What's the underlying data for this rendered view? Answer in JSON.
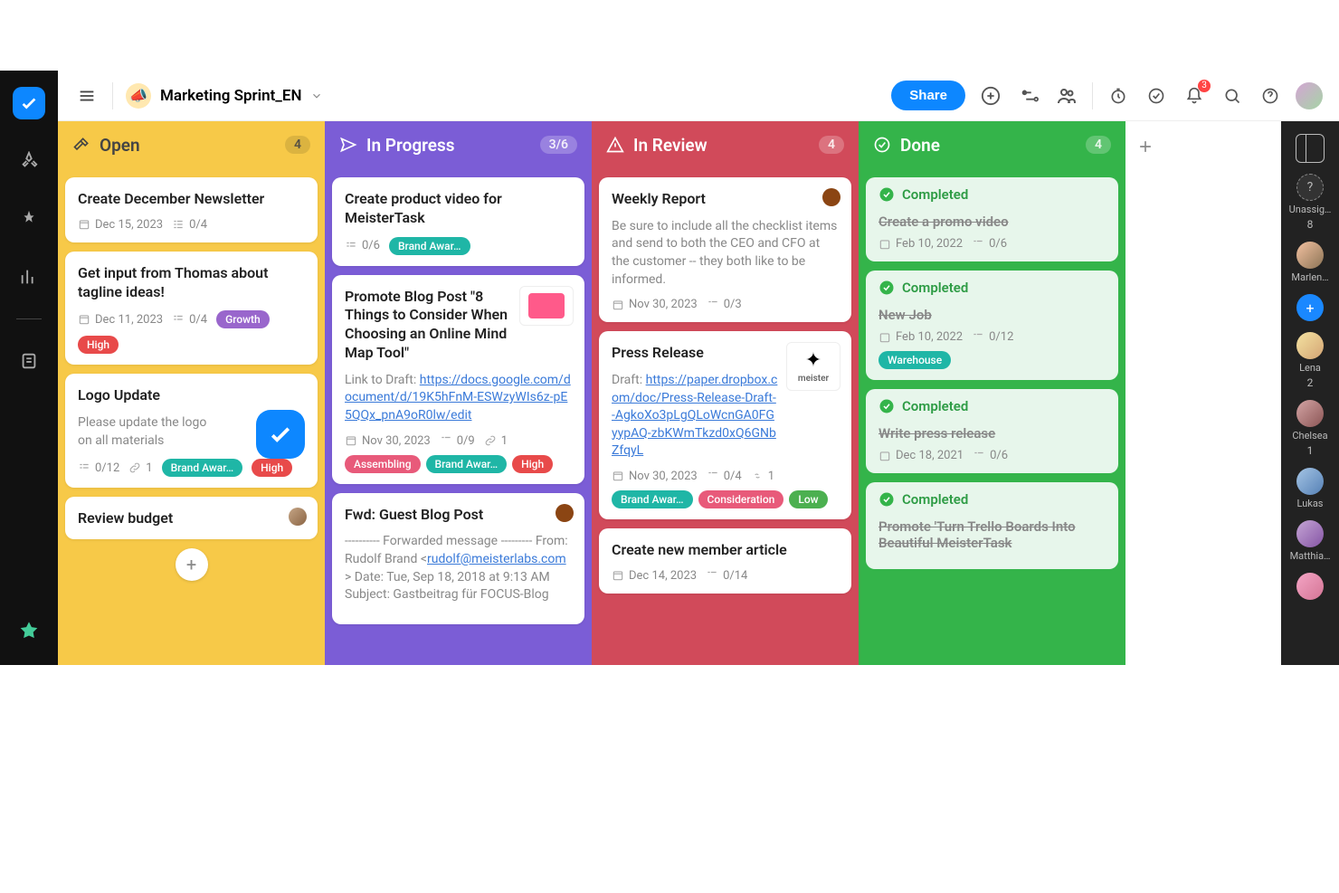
{
  "board": {
    "name": "Marketing Sprint_EN",
    "emoji": "📣"
  },
  "topbar": {
    "share": "Share",
    "notification_count": "3"
  },
  "columns": [
    {
      "key": "open",
      "title": "Open",
      "count": "4",
      "color": "yellow",
      "icon": "hammer"
    },
    {
      "key": "progress",
      "title": "In Progress",
      "count": "3/6",
      "color": "purple",
      "icon": "plane"
    },
    {
      "key": "review",
      "title": "In Review",
      "count": "4",
      "color": "red",
      "icon": "warning"
    },
    {
      "key": "done",
      "title": "Done",
      "count": "4",
      "color": "green",
      "icon": "check"
    }
  ],
  "open_cards": [
    {
      "title": "Create December Newsletter",
      "date": "Dec 15, 2023",
      "checklist": "0/4"
    },
    {
      "title": "Get input from Thomas about tagline ideas!",
      "date": "Dec 11, 2023",
      "checklist": "0/4",
      "tags": [
        "Growth",
        "High"
      ]
    },
    {
      "title": "Logo Update",
      "desc": "Please update the logo on all materials",
      "checklist": "0/12",
      "attachments": "1",
      "tags": [
        "Brand Awar…",
        "High"
      ],
      "bigcheck": true
    },
    {
      "title": "Review budget",
      "avatar": true
    }
  ],
  "progress_cards": [
    {
      "title": "Create product video for MeisterTask",
      "checklist": "0/6",
      "tags": [
        "Brand Awar…"
      ]
    },
    {
      "title": "Promote Blog Post \"8 Things to Consider When Choosing an Online Mind Map Tool\"",
      "desc_prefix": "Link to Draft:",
      "link": "https://docs.google.com/document/d/19K5hFnM-ESWzyWIs6z-pE5QQx_pnA9oR0lw/edit",
      "date": "Nov 30, 2023",
      "checklist": "0/9",
      "attachments": "1",
      "tags": [
        "Assembling",
        "Brand Awar…",
        "High"
      ],
      "thumb": "pink"
    },
    {
      "title": "Fwd: Guest Blog Post",
      "desc": "---------- Forwarded message --------- From: Rudolf Brand <",
      "email": "rudolf@meisterlabs.com",
      "desc2": "> Date: Tue, Sep 18, 2018 at 9:13 AM Subject: Gastbeitrag für FOCUS-Blog",
      "avatar": true
    }
  ],
  "review_cards": [
    {
      "title": "Weekly Report",
      "desc": "Be sure to include all the checklist items and send to both the CEO and CFO at the customer -- they both like to be informed.",
      "date": "Nov 30, 2023",
      "checklist": "0/3",
      "avatar": true
    },
    {
      "title": "Press Release",
      "desc_prefix": "Draft:",
      "link": "https://paper.dropbox.com/doc/Press-Release-Draft--AgkoXo3pLgQLoWcnGA0FGyypAQ-zbKWmTkzd0xQ6GNbZfqyL",
      "date": "Nov 30, 2023",
      "checklist": "0/4",
      "attachments": "1",
      "tags": [
        "Brand Awar…",
        "Consideration",
        "Low"
      ],
      "logo": "meister"
    },
    {
      "title": "Create new member article",
      "date": "Dec 14, 2023",
      "checklist": "0/14"
    }
  ],
  "done_cards": [
    {
      "status": "Completed",
      "title": "Create a promo video",
      "date": "Feb 10, 2022",
      "checklist": "0/6"
    },
    {
      "status": "Completed",
      "title": "New Job",
      "date": "Feb 10, 2022",
      "checklist": "0/12",
      "tags": [
        "Warehouse"
      ]
    },
    {
      "status": "Completed",
      "title": "Write press release",
      "date": "Dec 18, 2021",
      "checklist": "0/6"
    },
    {
      "status": "Completed",
      "title": "Promote 'Turn Trello Boards Into Beautiful MeisterTask"
    }
  ],
  "right_rail": {
    "unassigned": {
      "label": "Unassig…",
      "count": "8"
    },
    "people": [
      {
        "name": "Marlen…",
        "cls": "marlen"
      },
      {
        "name": "Lena",
        "count": "2",
        "cls": "lena"
      },
      {
        "name": "Chelsea",
        "count": "1",
        "cls": "chelsea"
      },
      {
        "name": "Lukas",
        "cls": "lukas"
      },
      {
        "name": "Matthia…",
        "cls": "matthias"
      }
    ]
  }
}
